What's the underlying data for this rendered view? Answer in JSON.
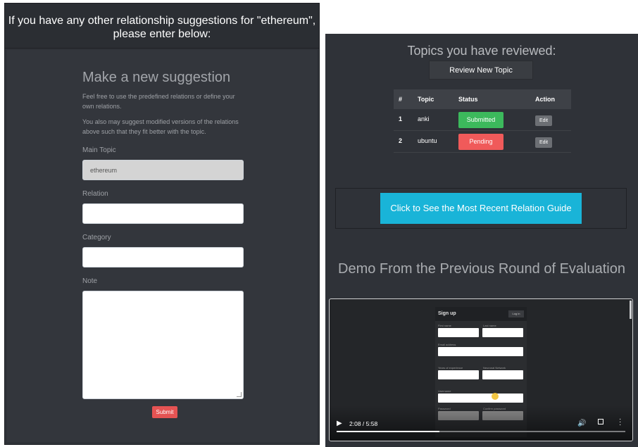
{
  "left": {
    "header": "If you have any other relationship suggestions for \"ethereum\", please enter below:",
    "form": {
      "title": "Make a new suggestion",
      "help1": "Feel free to use the predefined relations or define your own relations.",
      "help2": "You also may suggest modified versions of the relations above such that they fit better with the topic.",
      "main_topic_label": "Main Topic",
      "main_topic_value": "ethereum",
      "relation_label": "Relation",
      "relation_value": "",
      "category_label": "Category",
      "category_value": "",
      "note_label": "Note",
      "note_value": "",
      "submit_label": "Submit"
    }
  },
  "right": {
    "reviewed_title": "Topics you have reviewed:",
    "review_button": "Review New Topic",
    "table": {
      "headers": [
        "#",
        "Topic",
        "Status",
        "Action"
      ],
      "rows": [
        {
          "num": "1",
          "topic": "anki",
          "status": "Submitted",
          "action": "Edit"
        },
        {
          "num": "2",
          "topic": "ubuntu",
          "status": "Pending",
          "action": "Edit"
        }
      ]
    },
    "guide_button": "Click to See the Most Recent Relation Guide",
    "demo_title": "Demo From the Previous Round of Evaluation",
    "video": {
      "time": "2:08 / 5:58",
      "progress_fraction": 0.357,
      "embedded_form": {
        "title": "Sign up",
        "login": "Log in",
        "labels": [
          "First name",
          "Last name",
          "Email address",
          "Years of experience",
          "Neuronal Network",
          "Username",
          "Password",
          "Confirm password"
        ]
      }
    }
  },
  "colors": {
    "submitted": "#3cb95c",
    "pending": "#f05a5a",
    "guide": "#19b4d8",
    "submit": "#e55353"
  },
  "icons": [
    "play-icon",
    "volume-icon",
    "fullscreen-icon",
    "more-options-icon"
  ]
}
